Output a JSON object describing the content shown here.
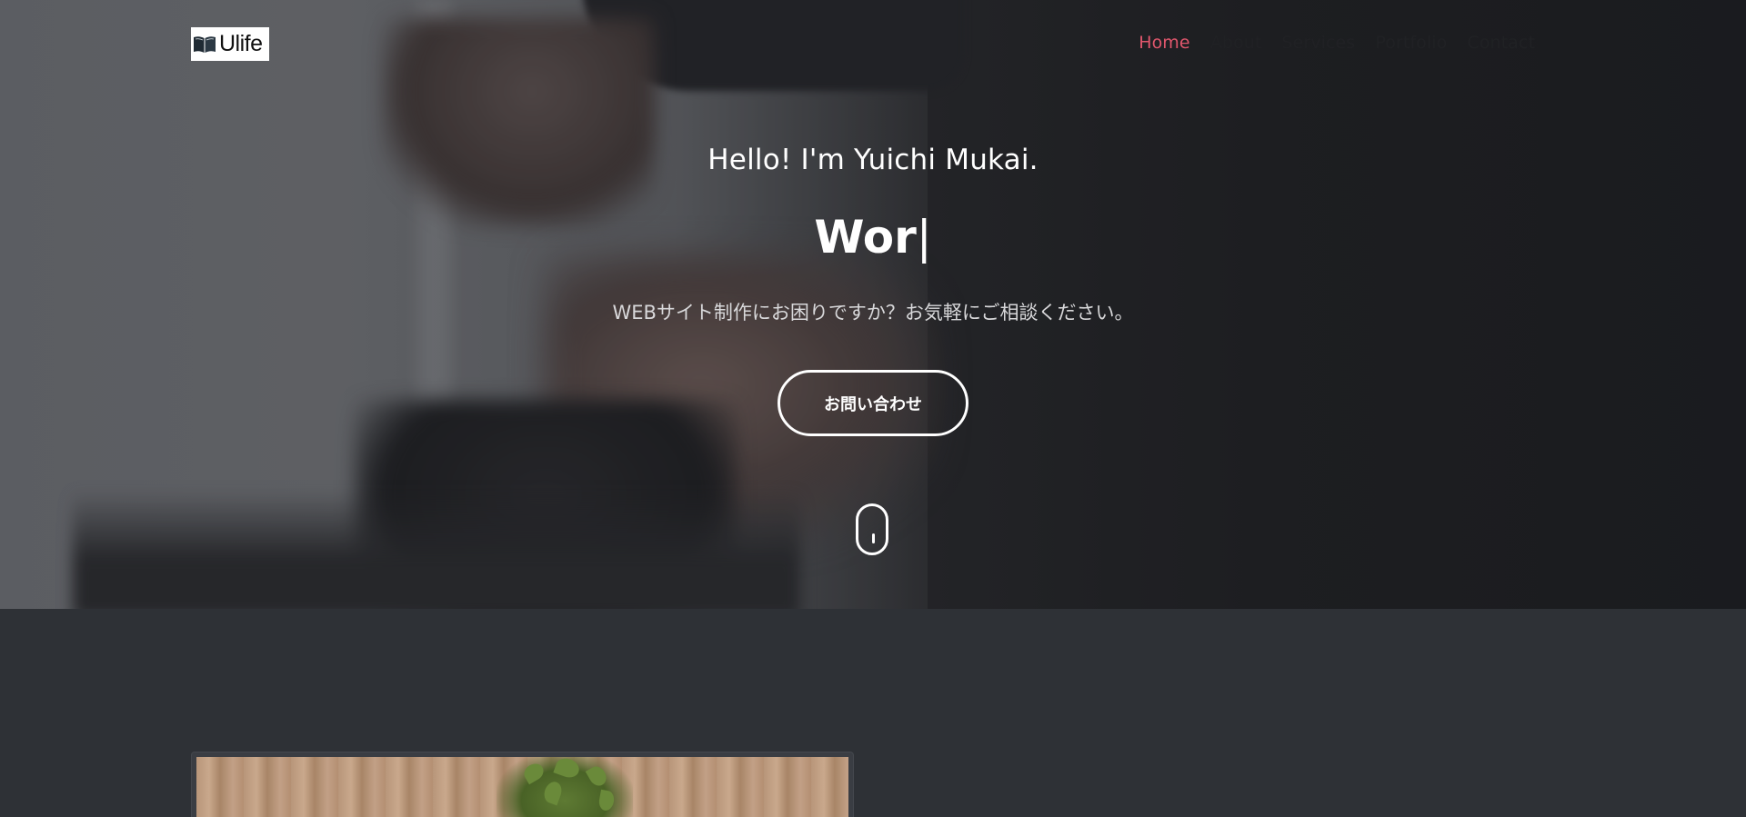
{
  "brand": {
    "logo_text": "Ulife",
    "logo_icon": "open-book-icon"
  },
  "nav": {
    "items": [
      {
        "label": "Home",
        "active": true
      },
      {
        "label": "About",
        "active": false
      },
      {
        "label": "Services",
        "active": false
      },
      {
        "label": "Portfolio",
        "active": false
      },
      {
        "label": "Contact",
        "active": false
      }
    ]
  },
  "hero": {
    "greeting": "Hello! I'm Yuichi Mukai.",
    "typed_text": "Wor",
    "typed_cursor": "|",
    "description": "WEBサイト制作にお困りですか？お気軽にご相談ください。",
    "cta_label": "お問い合わせ",
    "scroll_icon": "mouse-scroll-icon"
  },
  "colors": {
    "accent": "#e0566c",
    "nav_text": "#202124",
    "section_bg": "#2e3136"
  }
}
